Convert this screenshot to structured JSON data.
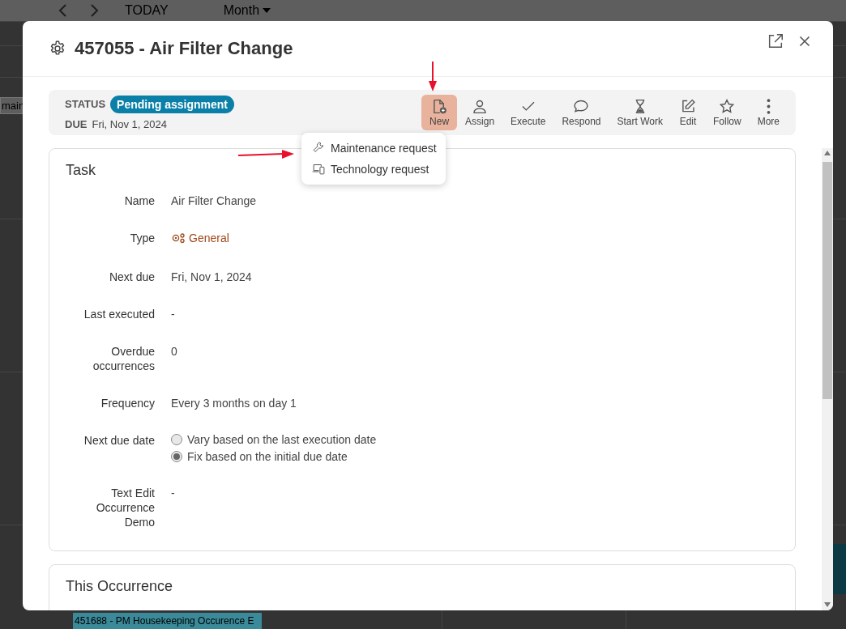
{
  "calendar": {
    "today": "TODAY",
    "view": "Month",
    "events": [
      {
        "text": "main"
      },
      {
        "text": "451688 - PM Housekeeping Occurence E"
      }
    ]
  },
  "dialog": {
    "title": "457055 - Air Filter Change",
    "status_label": "STATUS",
    "status": "Pending assignment",
    "due_label": "DUE",
    "due": "Fri, Nov 1, 2024",
    "actions": [
      {
        "label": "New",
        "selected": true
      },
      {
        "label": "Assign",
        "selected": false
      },
      {
        "label": "Execute",
        "selected": false
      },
      {
        "label": "Respond",
        "selected": false
      },
      {
        "label": "Start Work",
        "selected": false
      },
      {
        "label": "Edit",
        "selected": false
      },
      {
        "label": "Follow",
        "selected": false
      },
      {
        "label": "More",
        "selected": false
      }
    ],
    "menu": [
      {
        "label": "Maintenance request"
      },
      {
        "label": "Technology request"
      }
    ],
    "sections": [
      {
        "title": "Task",
        "fields": [
          {
            "label": "Name",
            "kind": "text",
            "value": "Air Filter Change"
          },
          {
            "label": "Type",
            "kind": "link",
            "value": "General"
          },
          {
            "label": "Next due",
            "kind": "text",
            "value": "Fri, Nov 1, 2024"
          },
          {
            "label": "Last executed",
            "kind": "text",
            "value": "-"
          },
          {
            "label": "Overdue occurrences",
            "kind": "text",
            "value": "0"
          },
          {
            "label": "Frequency",
            "kind": "text",
            "value": "Every 3 months on day 1"
          },
          {
            "label": "Next due date",
            "kind": "radio",
            "options": [
              {
                "label": "Vary based on the last execution date",
                "selected": false
              },
              {
                "label": "Fix based on the initial due date",
                "selected": true
              }
            ]
          },
          {
            "label": "Text Edit Occurrence Demo",
            "kind": "text",
            "value": "-"
          }
        ]
      },
      {
        "title": "This Occurrence"
      }
    ]
  }
}
